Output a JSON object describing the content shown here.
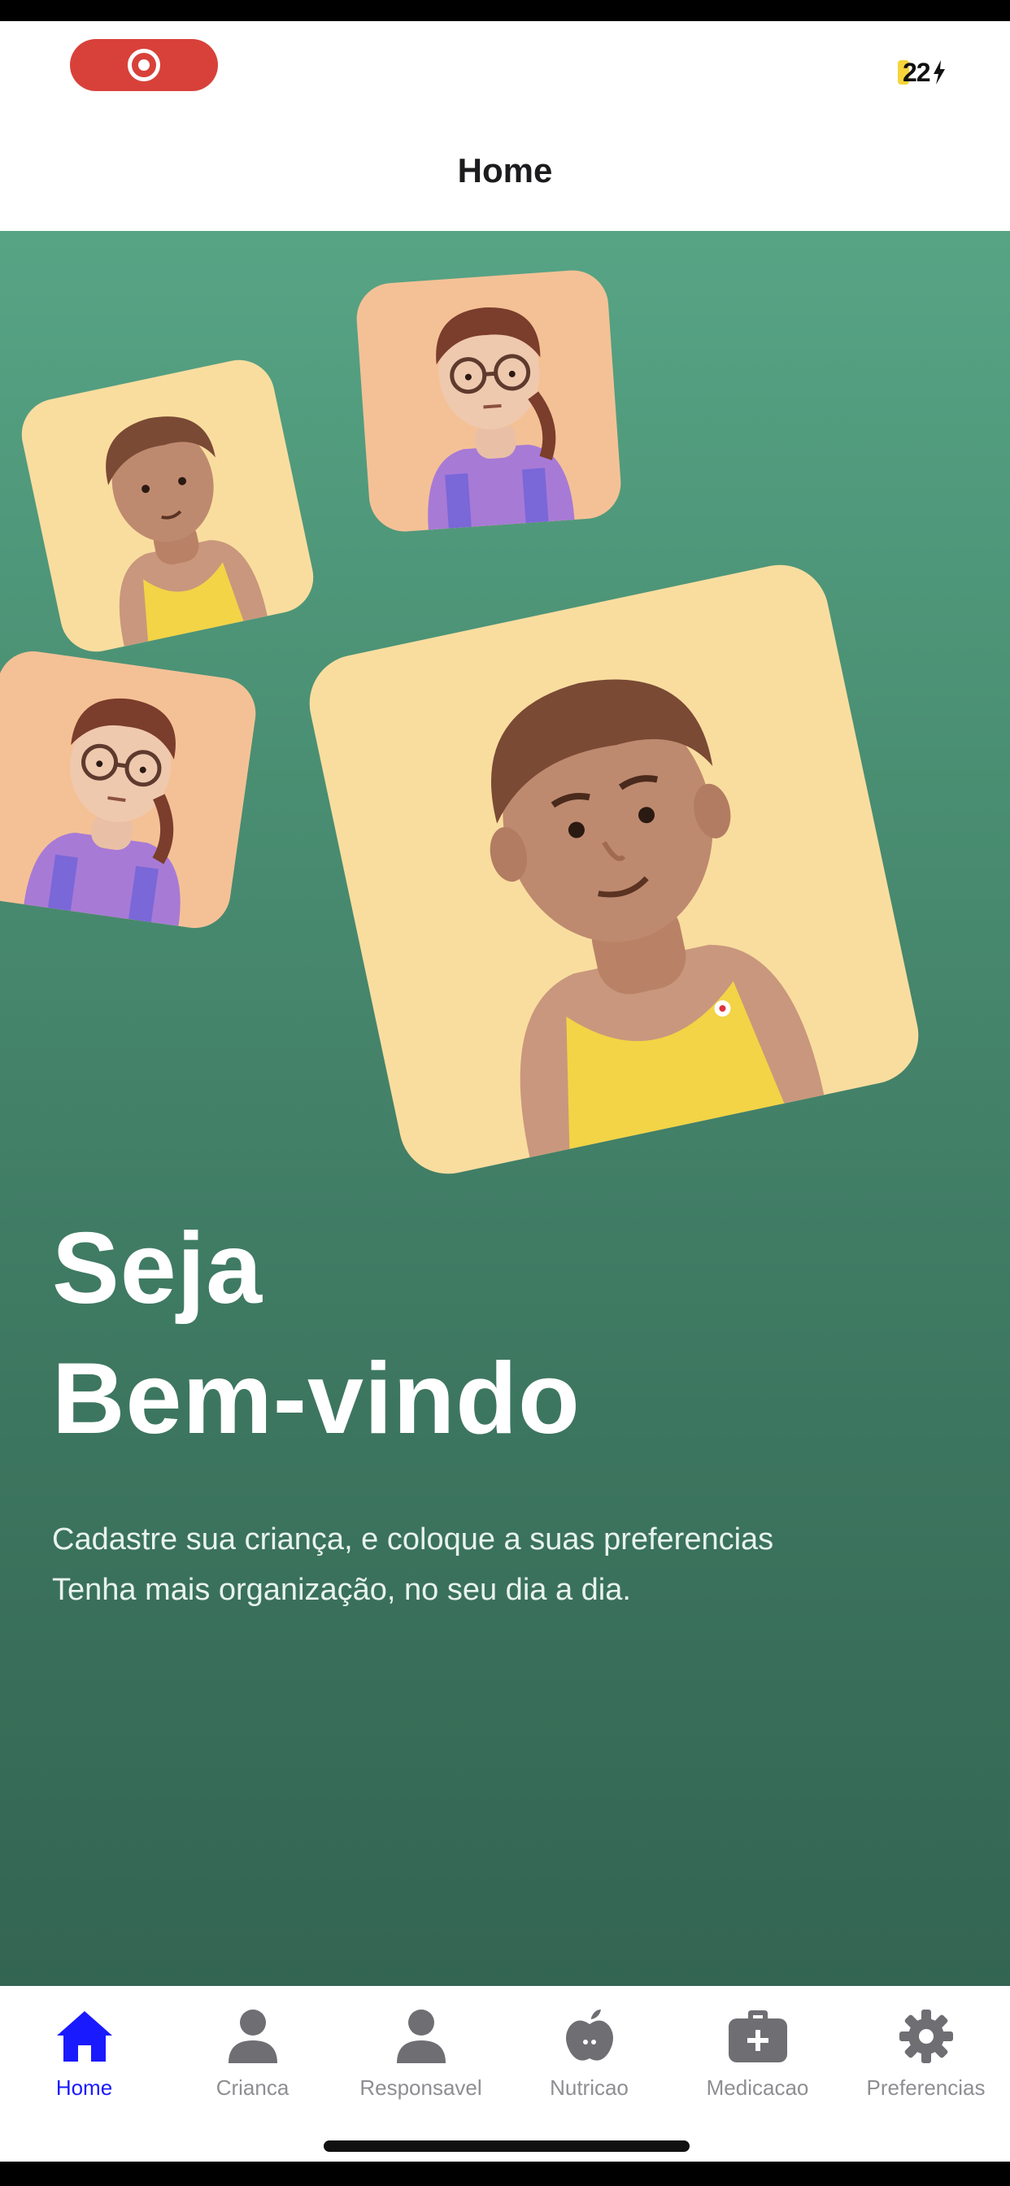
{
  "status_bar": {
    "battery": "22",
    "recording": true,
    "colors": {
      "record": "#d8413a",
      "battery": "#f6d43a"
    }
  },
  "header": {
    "title": "Home"
  },
  "hero": {
    "welcome_line1": "Seja",
    "welcome_line2": "Bem-vindo",
    "subtitle_line1": "Cadastre sua criança, e coloque a suas preferencias",
    "subtitle_line2": "Tenha mais organização, no seu dia a dia.",
    "colors": {
      "gradient_top": "#57a485",
      "gradient_bottom": "#336552",
      "card_yellow": "#f9dd9f",
      "card_peach": "#f4c196"
    }
  },
  "tabs": [
    {
      "label": "Home",
      "icon": "home-icon",
      "active": true
    },
    {
      "label": "Crianca",
      "icon": "person-icon",
      "active": false
    },
    {
      "label": "Responsavel",
      "icon": "person-icon",
      "active": false
    },
    {
      "label": "Nutricao",
      "icon": "apple-icon",
      "active": false
    },
    {
      "label": "Medicacao",
      "icon": "medkit-icon",
      "active": false
    },
    {
      "label": "Preferencias",
      "icon": "gear-icon",
      "active": false
    }
  ],
  "tab_colors": {
    "active": "#1a1aff",
    "inactive": "#8e8e93",
    "icon_inactive": "#6e6e73"
  }
}
